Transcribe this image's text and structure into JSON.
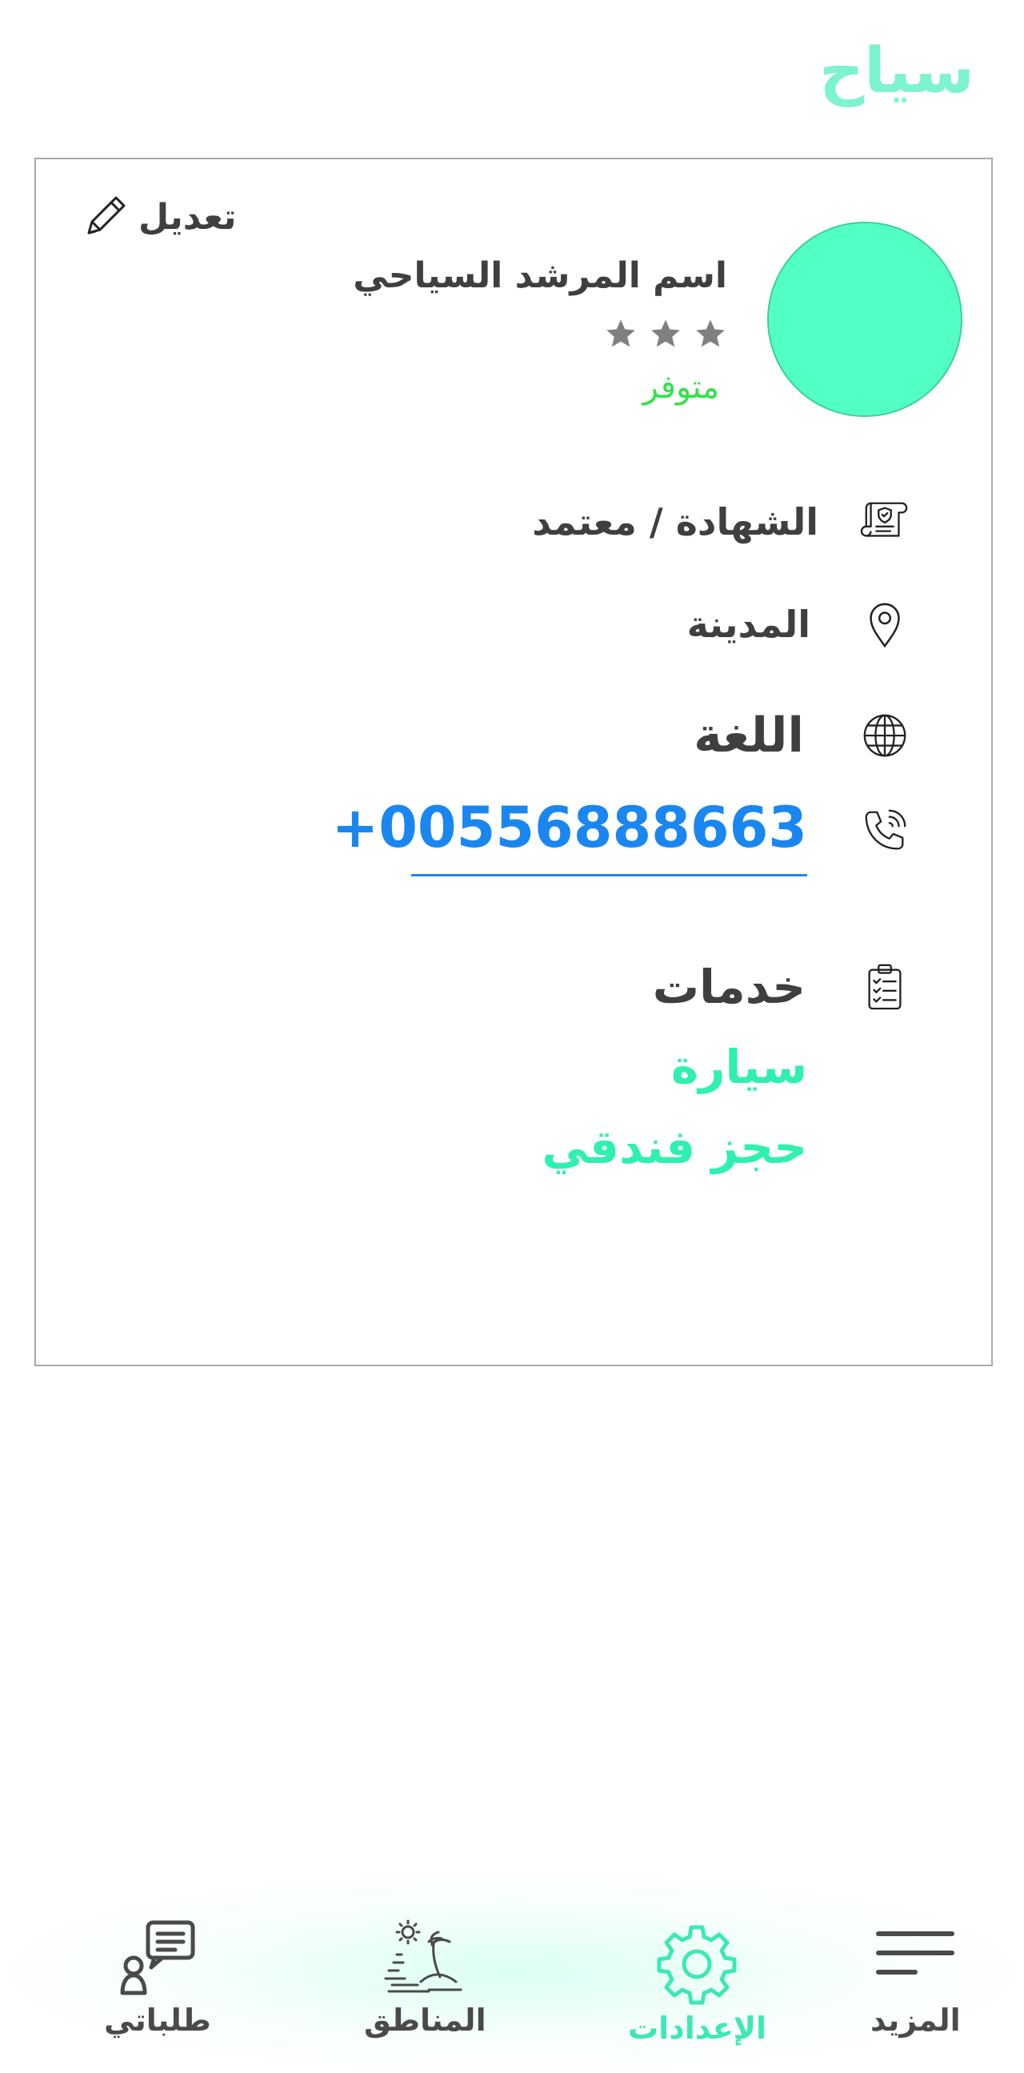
{
  "app": {
    "title": "سياح"
  },
  "profile": {
    "edit_label": "تعديل",
    "guide_name": "اسم المرشد السياحي",
    "rating": 3,
    "status": "متوفر",
    "certificate": "الشهادة / معتمد",
    "city": "المدينة",
    "language": "اللغة",
    "phone": "+00556888663",
    "services_title": "خدمات",
    "services": [
      "سيارة",
      "حجز فندقي"
    ]
  },
  "bottom_nav": {
    "items": [
      {
        "label": "طلباتي",
        "icon": "requests-icon",
        "active": false
      },
      {
        "label": "المناطق",
        "icon": "island-icon",
        "active": false
      },
      {
        "label": "الإعدادات",
        "icon": "gear-icon",
        "active": true
      },
      {
        "label": "المزيد",
        "icon": "menu-icon",
        "active": false
      }
    ]
  },
  "colors": {
    "accent": "#52ffc4",
    "title": "#7ef3cf",
    "link": "#1a86f0",
    "available": "#33e24a",
    "text": "#3f3f3f"
  }
}
